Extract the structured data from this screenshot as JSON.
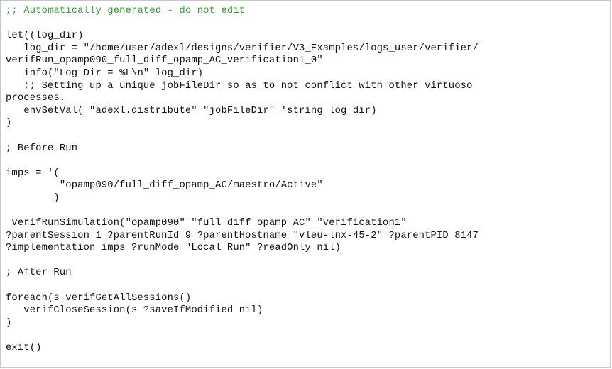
{
  "editor": {
    "lines": [
      ";; Automatically generated - do not edit",
      "",
      "let((log_dir)",
      "   log_dir = \"/home/user/adexl/designs/verifier/V3_Examples/logs_user/verifier/",
      "verifRun_opamp090_full_diff_opamp_AC_verification1_0\"",
      "   info(\"Log Dir = %L\\n\" log_dir)",
      "   ;; Setting up a unique jobFileDir so as to not conflict with other virtuoso",
      "processes.",
      "   envSetVal( \"adexl.distribute\" \"jobFileDir\" 'string log_dir)",
      ")",
      "",
      "; Before Run",
      "",
      "imps = '(",
      "         \"opamp090/full_diff_opamp_AC/maestro/Active\"",
      "        )",
      "",
      "_verifRunSimulation(\"opamp090\" \"full_diff_opamp_AC\" \"verification1\"",
      "?parentSession 1 ?parentRunId 9 ?parentHostname \"vleu-lnx-45-2\" ?parentPID 8147",
      "?implementation imps ?runMode \"Local Run\" ?readOnly nil)",
      "",
      "; After Run",
      "",
      "foreach(s verifGetAllSessions()",
      "   verifCloseSession(s ?saveIfModified nil)",
      ")",
      "",
      "exit()"
    ],
    "colors": {
      "background": "#ffffff",
      "text": "#111111",
      "header_comment": "#3a9a3a"
    }
  }
}
